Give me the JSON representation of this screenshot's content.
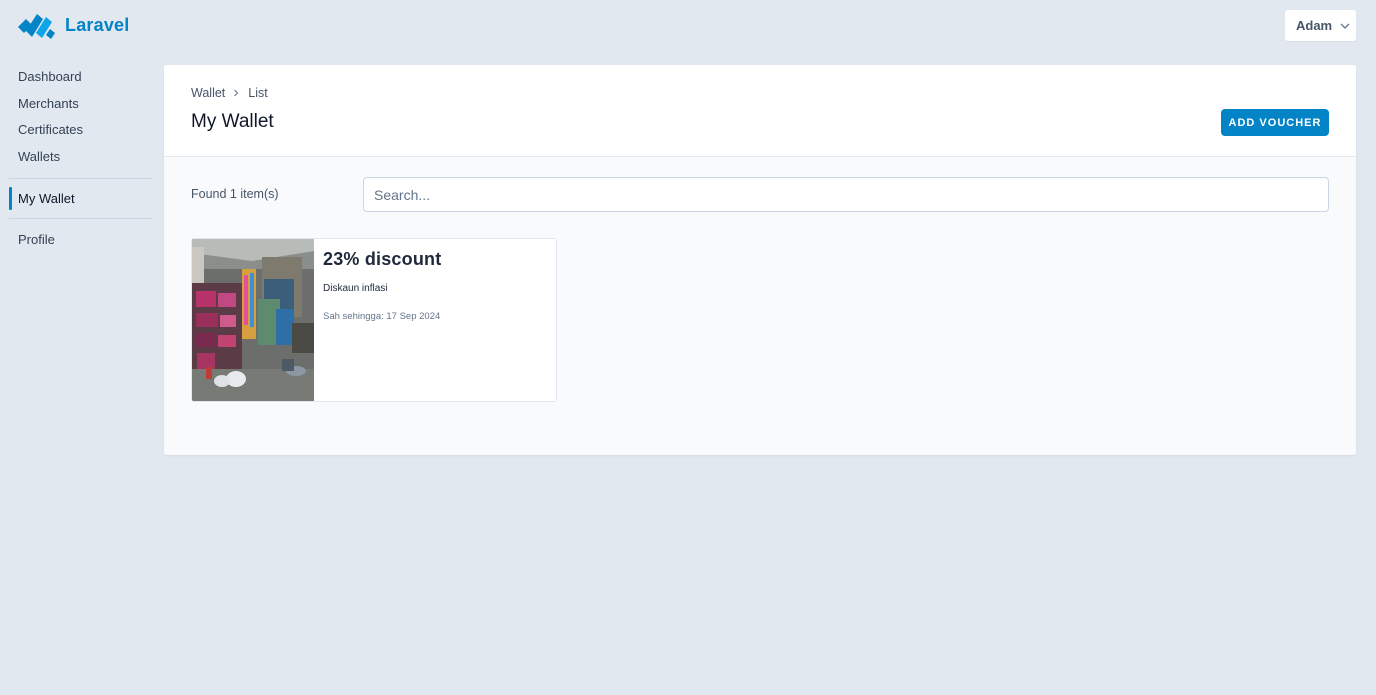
{
  "app": {
    "brand": "Laravel",
    "brand_color": "#0284c7",
    "logo_icon": "laravel-logo-icon"
  },
  "user_menu": {
    "name": "Adam",
    "icon": "chevron-down-icon"
  },
  "sidebar": {
    "items": [
      {
        "label": "Dashboard"
      },
      {
        "label": "Merchants"
      },
      {
        "label": "Certificates"
      },
      {
        "label": "Wallets"
      }
    ],
    "active_item": {
      "label": "My Wallet"
    },
    "bottom_items": [
      {
        "label": "Profile"
      }
    ]
  },
  "header": {
    "breadcrumb": [
      "Wallet",
      "List"
    ],
    "breadcrumb_separator_icon": "chevron-right-icon",
    "title": "My Wallet",
    "add_button_label": "ADD VOUCHER"
  },
  "toolbar": {
    "found_text": "Found 1 item(s)",
    "search_placeholder": "Search..."
  },
  "vouchers": [
    {
      "title": "23% discount",
      "description": "Diskaun inflasi",
      "valid_text": "Sah sehingga: 17 Sep 2024",
      "image": "shop-interior-photo"
    }
  ]
}
